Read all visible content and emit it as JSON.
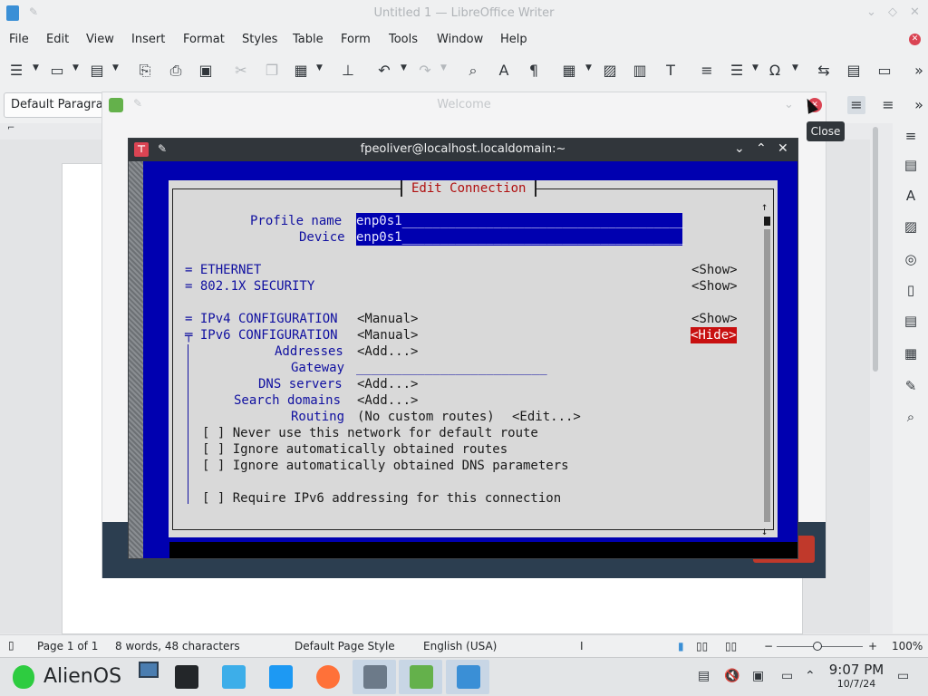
{
  "writer": {
    "title": "Untitled 1 — LibreOffice Writer",
    "menu": [
      "File",
      "Edit",
      "View",
      "Insert",
      "Format",
      "Styles",
      "Table",
      "Form",
      "Tools",
      "Window",
      "Help"
    ],
    "paragraph_style": "Default Paragraph Style",
    "tooltip": "Close",
    "status": {
      "page": "Page 1 of 1",
      "words": "8 words, 48 characters",
      "page_style": "Default Page Style",
      "language": "English (USA)",
      "zoom": "100%"
    }
  },
  "welcome": {
    "title": "Welcome"
  },
  "terminal": {
    "title": "fpeoliver@localhost.localdomain:~",
    "dialog": {
      "title": "Edit Connection",
      "profile_label": "Profile name",
      "profile_value": "enp0s1",
      "device_label": "Device",
      "device_value": "enp0s1",
      "ethernet": "= ETHERNET",
      "security": "= 802.1X SECURITY",
      "ipv4": "= IPv4 CONFIGURATION",
      "ipv6": "╤ IPv6 CONFIGURATION",
      "mode_manual": "<Manual>",
      "show": "<Show>",
      "hide": "<Hide>",
      "addresses_label": "Addresses",
      "gateway_label": "Gateway",
      "dns_label": "DNS servers",
      "search_label": "Search domains",
      "routing_label": "Routing",
      "add_btn": "<Add...>",
      "routing_value": "(No custom routes)",
      "edit_btn": "<Edit...>",
      "cb1": "[ ] Never use this network for default route",
      "cb2": "[ ] Ignore automatically obtained routes",
      "cb3": "[ ] Ignore automatically obtained DNS parameters",
      "cb4": "[ ] Require IPv6 addressing for this connection",
      "gateway_placeholder": "_________________________",
      "field_fill": "_____________________________________"
    }
  },
  "taskbar": {
    "start_label": "AlienOS",
    "time": "9:07 PM",
    "date": "10/7/24"
  }
}
